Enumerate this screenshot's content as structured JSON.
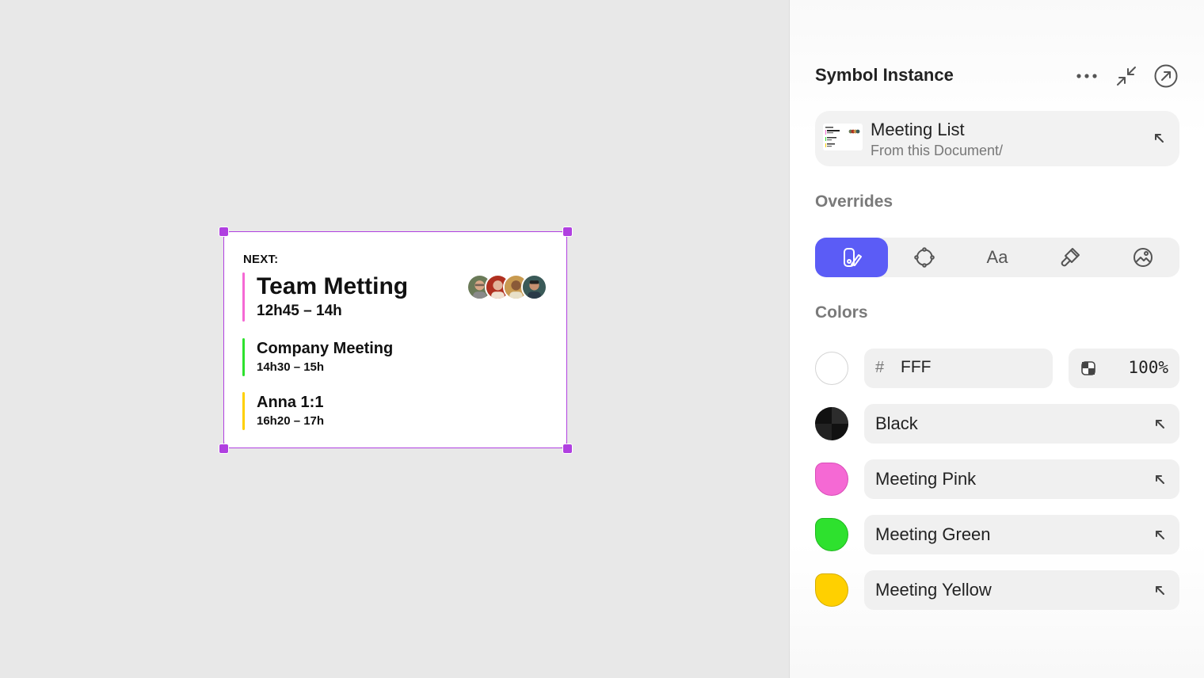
{
  "canvas": {
    "next_label": "NEXT:",
    "meetings": [
      {
        "title": "Team Metting",
        "time": "12h45 – 14h",
        "color": "#f569d4"
      },
      {
        "title": "Company Meeting",
        "time": "14h30 – 15h",
        "color": "#2ee12e"
      },
      {
        "title": "Anna 1:1",
        "time": "16h20 – 17h",
        "color": "#ffd000"
      }
    ],
    "attendees": [
      "avatar-1",
      "avatar-2",
      "avatar-3",
      "avatar-4"
    ],
    "selection_color": "#b040e0"
  },
  "inspector": {
    "title": "Symbol Instance",
    "header_icons": [
      "more-icon",
      "collapse-icon",
      "open-external-icon"
    ],
    "symbol": {
      "name": "Meeting List",
      "source": "From this Document/"
    },
    "overrides_title": "Overrides",
    "override_tabs": [
      {
        "icon": "fill-brush-icon",
        "active": true
      },
      {
        "icon": "symbol-swap-icon",
        "active": false
      },
      {
        "icon": "text-style-icon",
        "label": "Aa",
        "active": false
      },
      {
        "icon": "paint-brush-icon",
        "active": false
      },
      {
        "icon": "image-override-icon",
        "active": false
      }
    ],
    "accent_color": "#5b5cf6",
    "colors_title": "Colors",
    "hex": {
      "hash": "#",
      "value": "FFF"
    },
    "opacity": "100%",
    "color_refs": [
      {
        "name": "Black",
        "swatch": "#222222"
      },
      {
        "name": "Meeting Pink",
        "swatch": "#f569d4"
      },
      {
        "name": "Meeting Green",
        "swatch": "#2ee12e"
      },
      {
        "name": "Meeting Yellow",
        "swatch": "#ffd000"
      }
    ]
  }
}
